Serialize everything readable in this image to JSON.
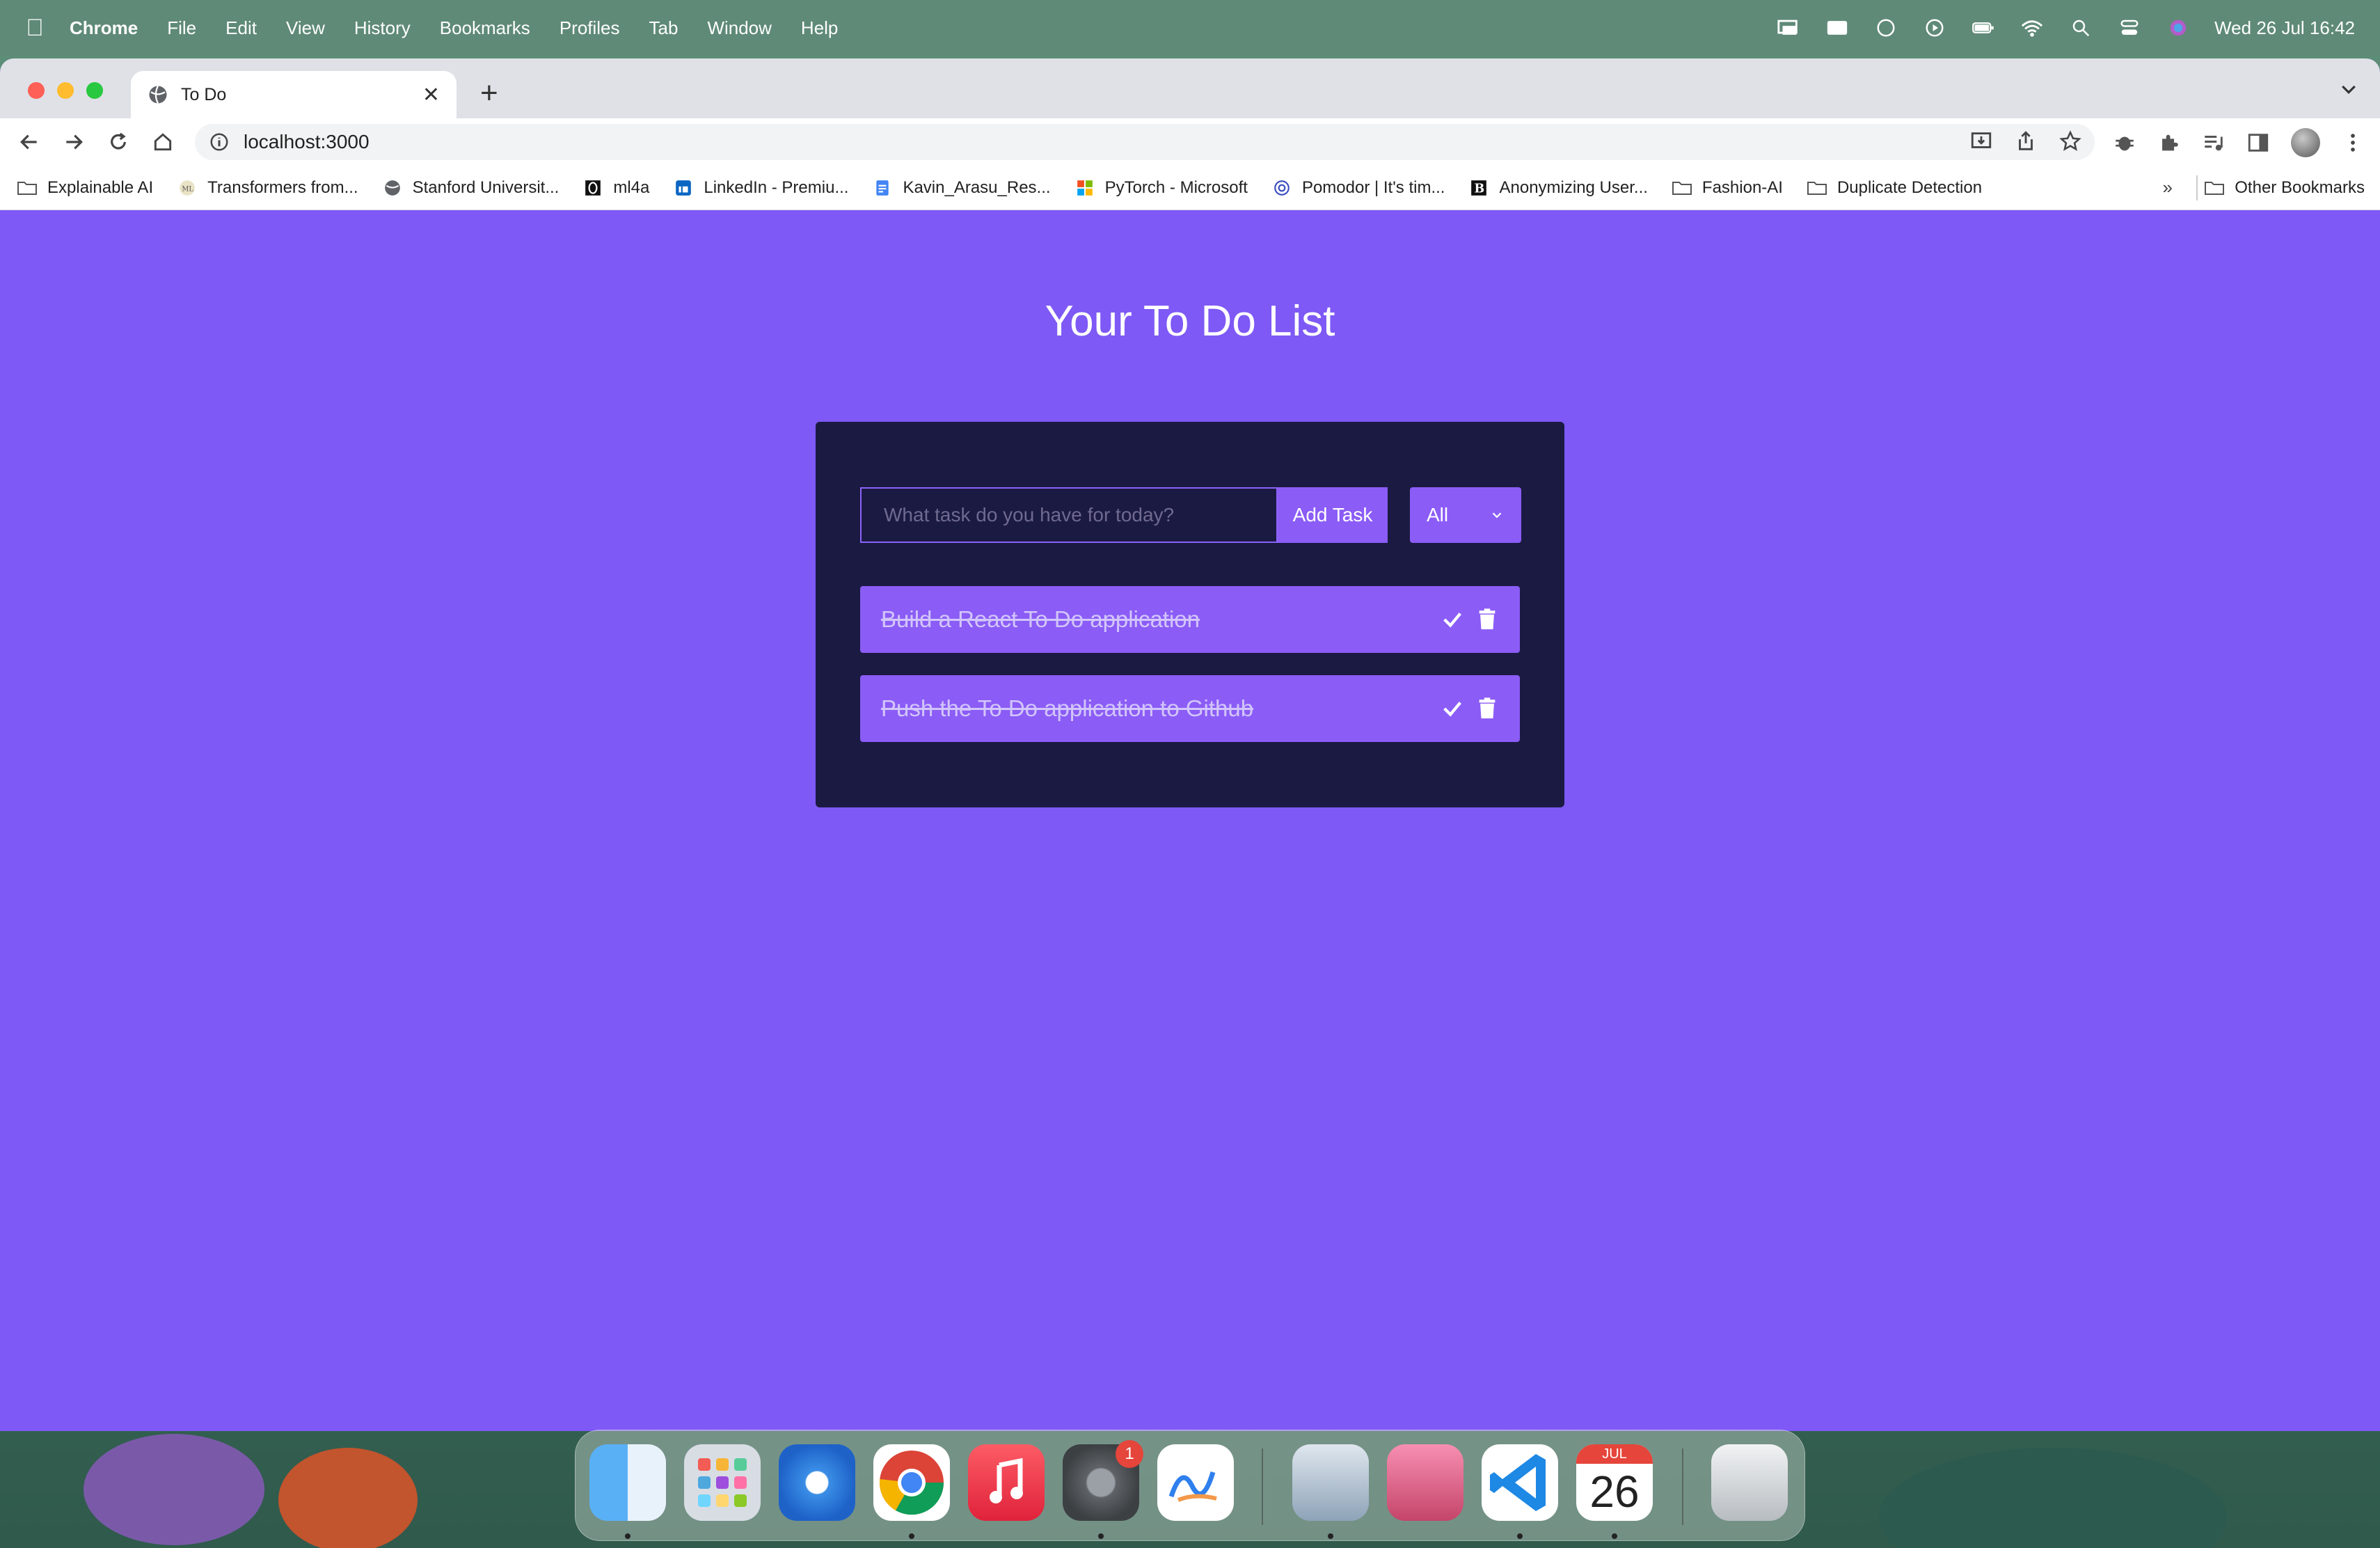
{
  "menubar": {
    "app": "Chrome",
    "items": [
      "File",
      "Edit",
      "View",
      "History",
      "Bookmarks",
      "Profiles",
      "Tab",
      "Window",
      "Help"
    ],
    "datetime": "Wed 26 Jul  16:42"
  },
  "browser": {
    "tab_title": "To Do",
    "url": "localhost:3000",
    "bookmarks": [
      "Explainable AI",
      "Transformers from...",
      "Stanford Universit...",
      "ml4a",
      "LinkedIn - Premiu...",
      "Kavin_Arasu_Res...",
      "PyTorch - Microsoft",
      "Pomodor | It's tim...",
      "Anonymizing User...",
      "Fashion-AI",
      "Duplicate Detection"
    ],
    "more": "»",
    "other_bookmarks": "Other Bookmarks"
  },
  "app": {
    "title": "Your To Do List",
    "input_placeholder": "What task do you have for today?",
    "add_button": "Add Task",
    "filter_value": "All",
    "todos": [
      {
        "text": "Build a React To Do application",
        "completed": true
      },
      {
        "text": "Push the To Do application to Github",
        "completed": true
      }
    ]
  },
  "dock": {
    "calendar_month": "JUL",
    "calendar_day": "26",
    "settings_badge": "1"
  },
  "colors": {
    "page_bg": "#7e59f5",
    "card_bg": "#1b1a43",
    "accent": "#8b5cf6"
  }
}
